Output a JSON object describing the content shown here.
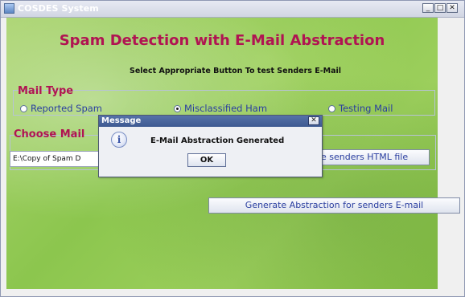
{
  "window": {
    "title": "COSDES System",
    "controls": {
      "minimize": "_",
      "maximize": "□",
      "close": "✕"
    }
  },
  "header": {
    "title": "Spam Detection with E-Mail Abstraction",
    "subtitle": "Select Appropriate Button To test Senders E-Mail"
  },
  "mail_type": {
    "label": "Mail Type",
    "options": [
      {
        "label": "Reported Spam",
        "selected": false
      },
      {
        "label": "Misclassified Ham",
        "selected": true
      },
      {
        "label": "Testing Mail",
        "selected": false
      }
    ]
  },
  "choose_mail": {
    "label": "Choose Mail",
    "path_value": "E:\\Copy of Spam D",
    "browse_label": "e senders HTML file"
  },
  "generate_button": "Generate Abstraction for senders E-mail",
  "dialog": {
    "title": "Message",
    "close": "✕",
    "icon": "info-icon",
    "icon_glyph": "i",
    "message": "E-Mail Abstraction Generated",
    "ok_label": "OK"
  },
  "colors": {
    "accent": "#b01452",
    "radio_text": "#2a3ea0",
    "background_green": "#98cc58"
  }
}
